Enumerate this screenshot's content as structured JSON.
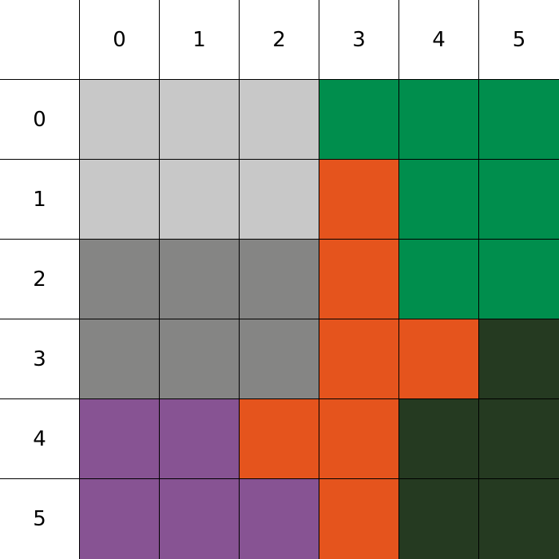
{
  "grid": {
    "col_headers": [
      "0",
      "1",
      "2",
      "3",
      "4",
      "5"
    ],
    "row_headers": [
      "0",
      "1",
      "2",
      "3",
      "4",
      "5"
    ],
    "palette": {
      "light-gray": "#c8c8c8",
      "gray": "#858584",
      "green": "#008e4d",
      "orange": "#e5541d",
      "dark-green": "#253a21",
      "purple": "#875393"
    },
    "cells": [
      [
        "light-gray",
        "light-gray",
        "light-gray",
        "green",
        "green",
        "green"
      ],
      [
        "light-gray",
        "light-gray",
        "light-gray",
        "orange",
        "green",
        "green"
      ],
      [
        "gray",
        "gray",
        "gray",
        "orange",
        "green",
        "green"
      ],
      [
        "gray",
        "gray",
        "gray",
        "orange",
        "orange",
        "dark-green"
      ],
      [
        "purple",
        "purple",
        "orange",
        "orange",
        "dark-green",
        "dark-green"
      ],
      [
        "purple",
        "purple",
        "purple",
        "orange",
        "dark-green",
        "dark-green"
      ]
    ]
  }
}
